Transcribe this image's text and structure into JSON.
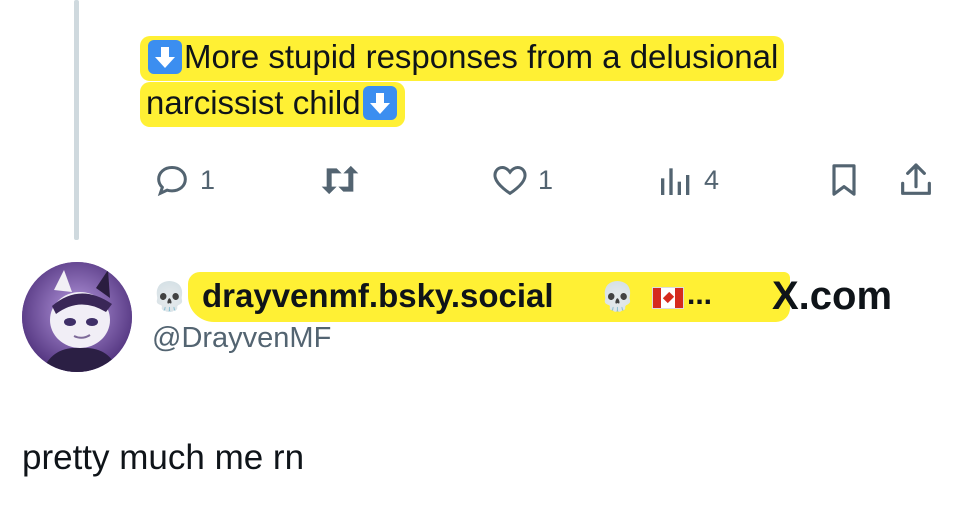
{
  "previous_tweet": {
    "text_line1": "More stupid responses from a delusional",
    "text_line2": "narcissist child",
    "emoji": "down-arrow-emoji",
    "actions": {
      "reply_count": "1",
      "repost_count": "",
      "like_count": "1",
      "views_count": "4"
    }
  },
  "tweet": {
    "display_name": "drayvenmf.bsky.social",
    "name_emoji": "skull-emoji",
    "flag": "canada-flag",
    "truncation": "...",
    "handle": "@DrayvenMF",
    "source_brand": "X.com",
    "text": "pretty much me rn"
  },
  "colors": {
    "highlight": "#fff034",
    "secondary_text": "#536471",
    "thread_line": "#cfd9de",
    "emoji_blue": "#3b8ef0",
    "avatar_purple": "#7b5ba8"
  }
}
